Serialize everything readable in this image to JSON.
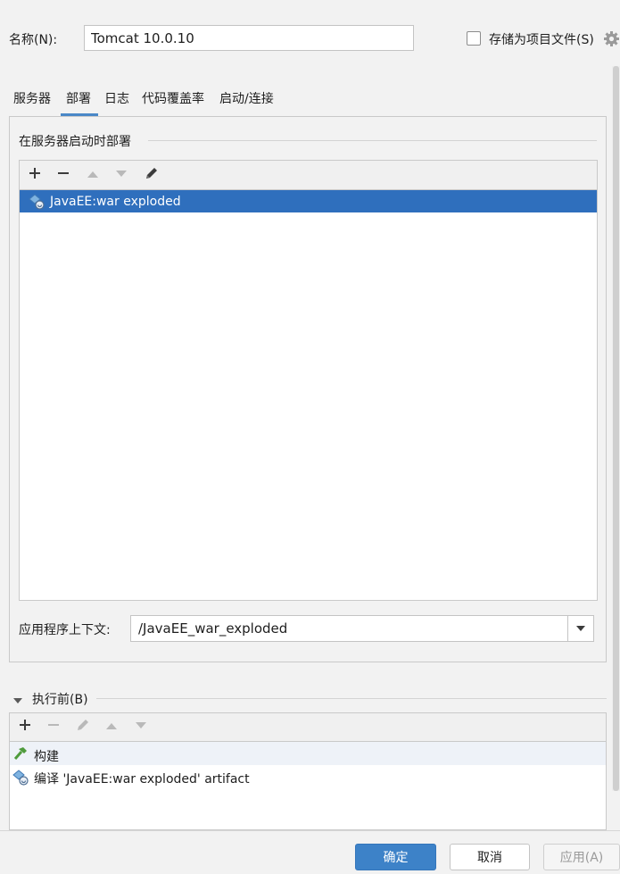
{
  "header": {
    "name_label": "名称(N):",
    "name_value": "Tomcat 10.0.10",
    "store_label": "存储为项目文件(S)"
  },
  "tabs": [
    {
      "label": "服务器",
      "active": false
    },
    {
      "label": "部署",
      "active": true
    },
    {
      "label": "日志",
      "active": false
    },
    {
      "label": "代码覆盖率",
      "active": false
    },
    {
      "label": "启动/连接",
      "active": false
    }
  ],
  "deploy": {
    "section_title": "在服务器启动时部署",
    "artifacts": [
      "JavaEE:war exploded"
    ],
    "context_label": "应用程序上下文:",
    "context_value": "/JavaEE_war_exploded"
  },
  "before_launch": {
    "title": "执行前(B)",
    "tasks": [
      {
        "icon": "hammer-icon",
        "label": "构建"
      },
      {
        "icon": "artifact-icon",
        "label": "编译 'JavaEE:war exploded' artifact"
      }
    ]
  },
  "buttons": {
    "ok": "确定",
    "cancel": "取消",
    "apply": "应用(A)"
  },
  "colors": {
    "selection": "#2f6fbd",
    "accent": "#4a88c7",
    "primary_button": "#3d82c8"
  }
}
